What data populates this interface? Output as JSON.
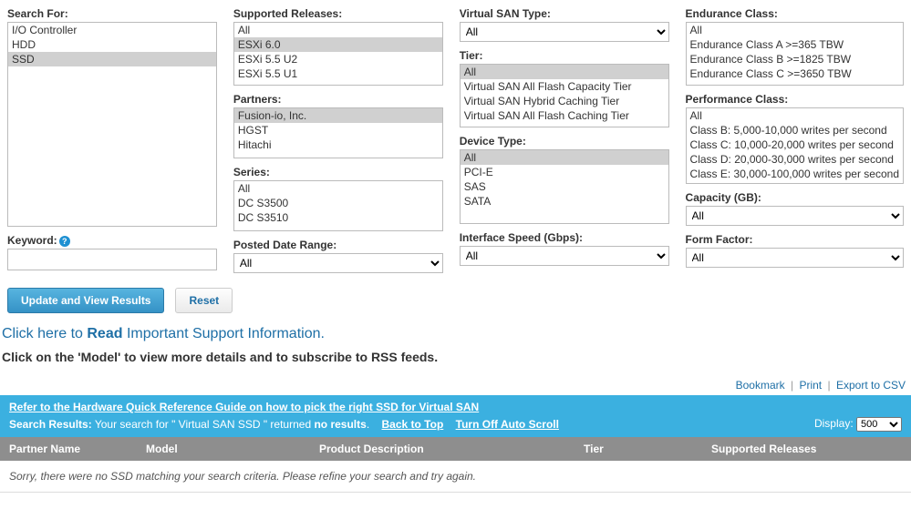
{
  "filters": {
    "search_for": {
      "label": "Search For:",
      "items": [
        "I/O Controller",
        "HDD",
        "SSD"
      ],
      "selected": "SSD"
    },
    "keyword": {
      "label": "Keyword:",
      "value": ""
    },
    "supported_releases": {
      "label": "Supported Releases:",
      "items": [
        "All",
        "ESXi 6.0",
        "ESXi 5.5 U2",
        "ESXi 5.5 U1"
      ],
      "selected": "ESXi 6.0"
    },
    "partners": {
      "label": "Partners:",
      "items": [
        "Fusion-io, Inc.",
        "HGST",
        "Hitachi"
      ],
      "selected": "Fusion-io, Inc."
    },
    "series": {
      "label": "Series:",
      "items": [
        "All",
        "DC S3500",
        "DC S3510"
      ],
      "selected": null
    },
    "posted_date": {
      "label": "Posted Date Range:",
      "value": "All"
    },
    "vsan_type": {
      "label": "Virtual SAN Type:",
      "value": "All"
    },
    "tier": {
      "label": "Tier:",
      "items": [
        "All",
        "Virtual SAN All Flash Capacity Tier",
        "Virtual SAN Hybrid Caching Tier",
        "Virtual SAN All Flash Caching Tier"
      ],
      "selected": "All"
    },
    "device_type": {
      "label": "Device Type:",
      "items": [
        "All",
        "PCI-E",
        "SAS",
        "SATA"
      ],
      "selected": "All"
    },
    "iface_speed": {
      "label": "Interface Speed (Gbps):",
      "value": "All"
    },
    "endurance": {
      "label": "Endurance Class:",
      "items": [
        "All",
        "Endurance Class A >=365 TBW",
        "Endurance Class B >=1825 TBW",
        "Endurance Class C >=3650 TBW"
      ],
      "selected": null
    },
    "perf": {
      "label": "Performance Class:",
      "items": [
        "All",
        "Class B: 5,000-10,000 writes per second",
        "Class C: 10,000-20,000 writes per second",
        "Class D: 20,000-30,000 writes per second",
        "Class E: 30,000-100,000 writes per second"
      ],
      "selected": null
    },
    "capacity": {
      "label": "Capacity (GB):",
      "value": "All"
    },
    "form_factor": {
      "label": "Form Factor:",
      "value": "All"
    }
  },
  "actions": {
    "update": "Update and View Results",
    "reset": "Reset"
  },
  "support": {
    "prefix": "Click here to ",
    "strong": "Read",
    "suffix": " Important Support Information."
  },
  "instruct": "Click on the 'Model' to view more details and to subscribe to RSS feeds.",
  "export": {
    "bookmark": "Bookmark",
    "print": "Print",
    "csv": "Export to CSV"
  },
  "bluebar": {
    "guide": "Refer to the Hardware Quick Reference Guide on how to pick the right SSD for Virtual SAN",
    "results_prefix": "Search Results:",
    "results_text": " Your search for \" Virtual SAN SSD \" returned ",
    "results_strong": "no results",
    "results_suffix": ".",
    "back_top": "Back to Top",
    "auto_scroll": "Turn Off Auto Scroll",
    "display_label": "Display:",
    "display_value": "500"
  },
  "table": {
    "headers": [
      "Partner Name",
      "Model",
      "Product Description",
      "Tier",
      "Supported Releases"
    ],
    "empty": "Sorry, there were no SSD matching your search criteria. Please refine your search and try again."
  },
  "chart_data": {
    "type": "table",
    "rows": []
  }
}
